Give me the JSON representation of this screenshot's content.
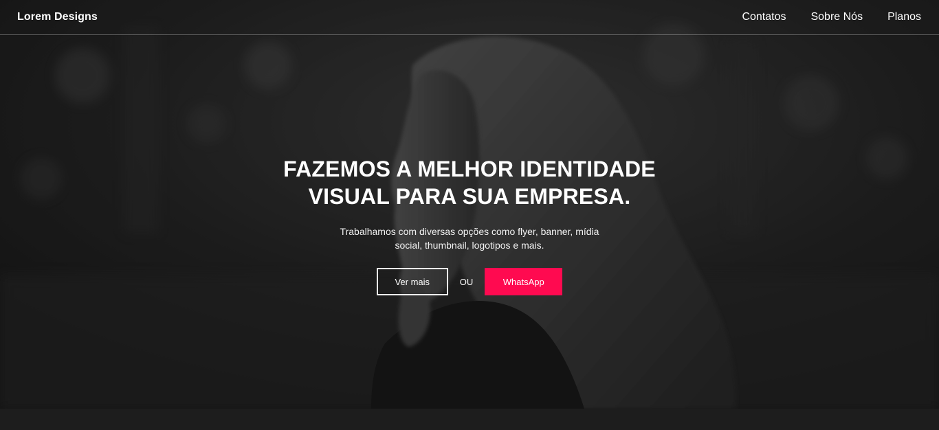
{
  "navbar": {
    "brand": "Lorem Designs",
    "links": [
      {
        "label": "Contatos"
      },
      {
        "label": "Sobre Nós"
      },
      {
        "label": "Planos"
      }
    ]
  },
  "hero": {
    "title": "FAZEMOS A MELHOR IDENTIDADE VISUAL PARA SUA EMPRESA.",
    "subtitle": "Trabalhamos com diversas opções como flyer, banner, mídia social, thumbnail, logotipos e mais.",
    "primary_cta": "Ver mais",
    "separator": "OU",
    "secondary_cta": "WhatsApp",
    "background_image": "woman-portrait-grayscale"
  },
  "colors": {
    "accent": "#ff0a50",
    "overlay": "#2b2b2b",
    "footer": "#1d1d1d"
  }
}
